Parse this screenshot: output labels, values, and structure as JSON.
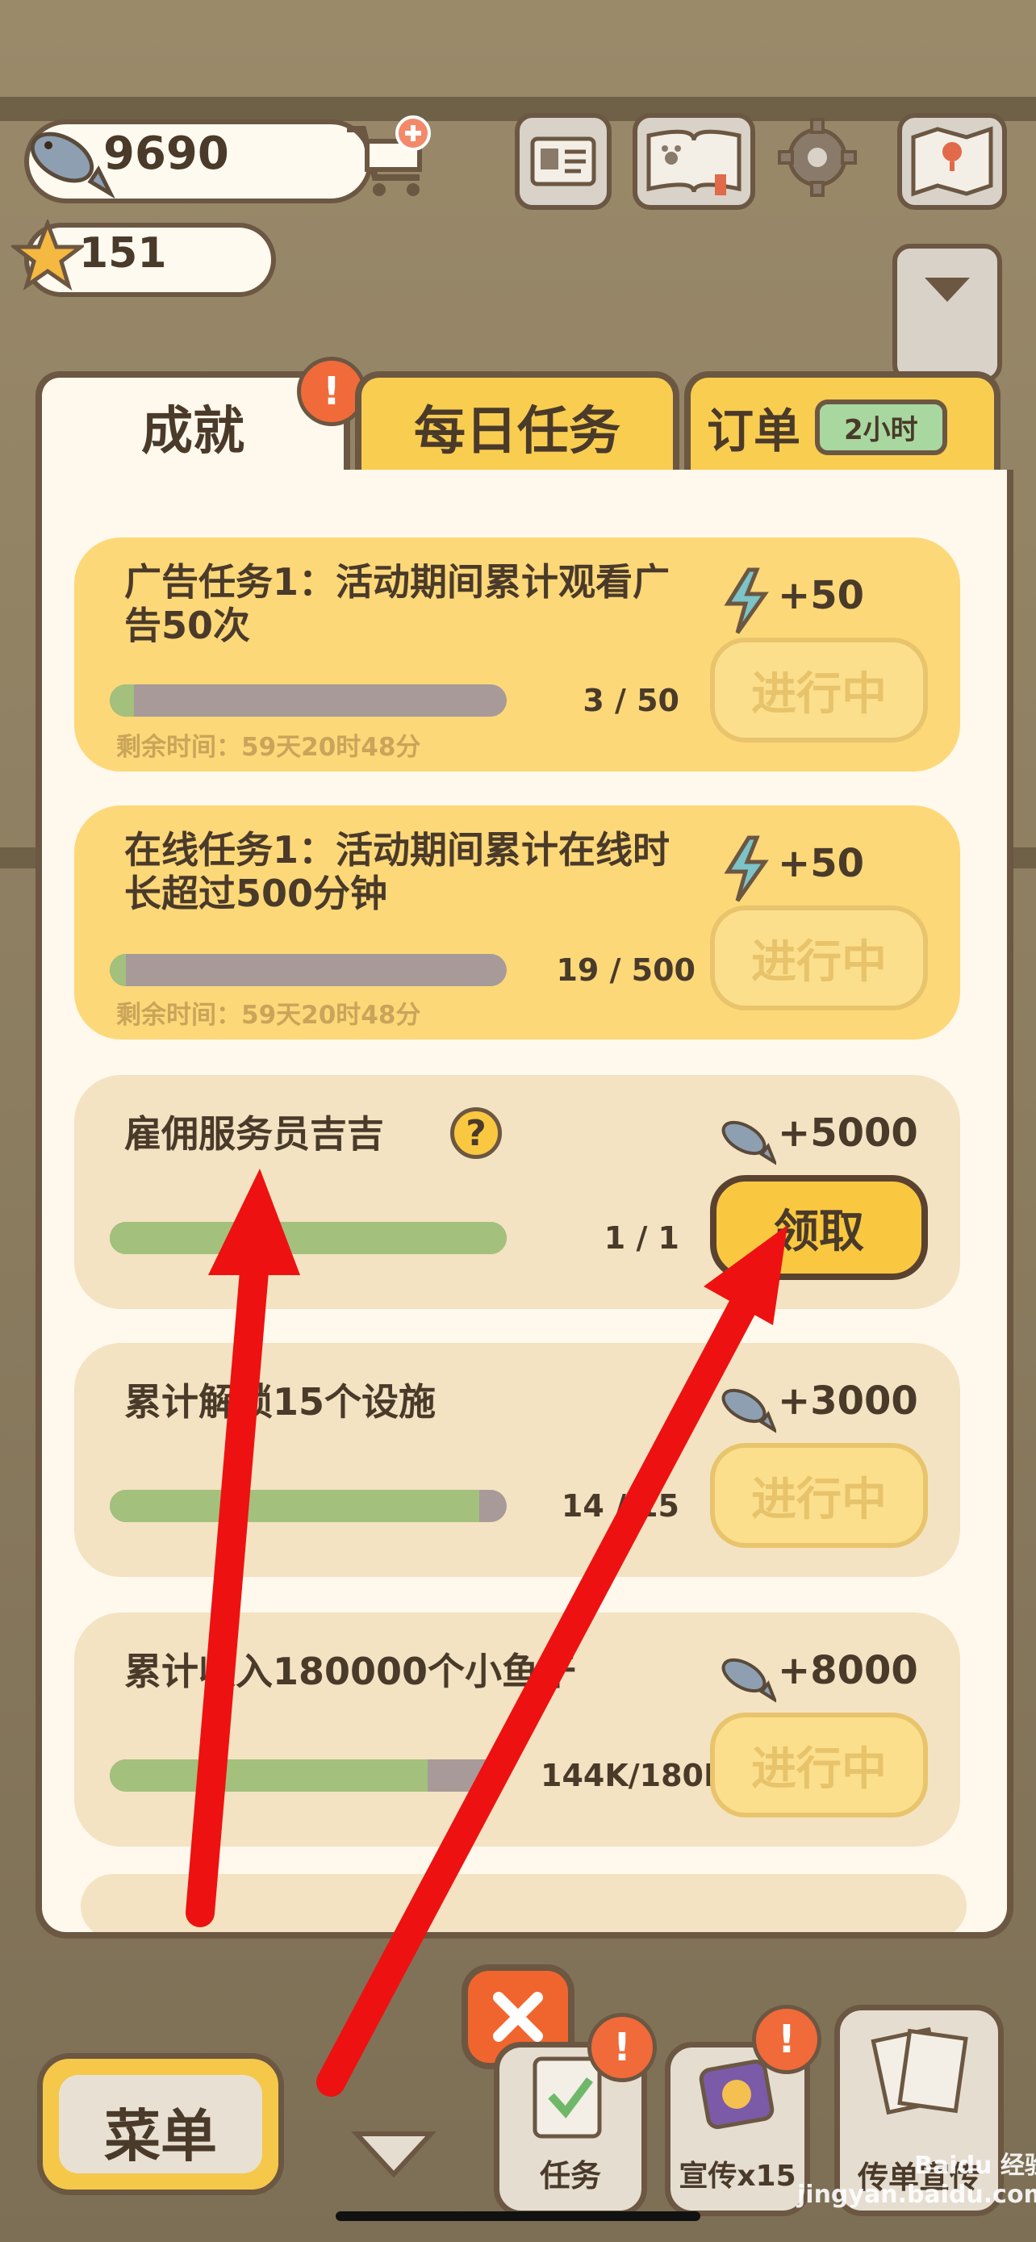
{
  "hud": {
    "fish_count": "9690",
    "star_count": "151"
  },
  "tabs": {
    "achievements": "成就",
    "daily": "每日任务",
    "orders": "订单",
    "orders_timer": "2小时"
  },
  "tasks": [
    {
      "title": "广告任务1：活动期间累计观看广告50次",
      "progress": "3  /  50",
      "progress_fraction": 0.06,
      "remaining": "剩余时间：59天20时48分",
      "reward": "+50",
      "reward_icon": "lightning-icon",
      "button": "进行中"
    },
    {
      "title": "在线任务1：活动期间累计在线时长超过500分钟",
      "progress": "19  / 500",
      "progress_fraction": 0.04,
      "remaining": "剩余时间：59天20时48分",
      "reward": "+50",
      "reward_icon": "lightning-icon",
      "button": "进行中"
    },
    {
      "title": "雇佣服务员吉吉",
      "progress": "1  /  1",
      "progress_fraction": 1.0,
      "reward": "+5000",
      "reward_icon": "fish-icon",
      "button": "领取"
    },
    {
      "title": "累计解锁15个设施",
      "progress": "14  /  15",
      "progress_fraction": 0.93,
      "reward": "+3000",
      "reward_icon": "fish-icon",
      "button": "进行中"
    },
    {
      "title": "累计收入180000个小鱼干",
      "progress": "144K/180K",
      "progress_fraction": 0.8,
      "reward": "+8000",
      "reward_icon": "fish-icon",
      "button": "进行中"
    }
  ],
  "bottom": {
    "menu": "菜单",
    "tasks": "任务",
    "promo": "宣传x15",
    "flyer": "传单宣传"
  },
  "watermark": "Baidu 经验\njingyan.baidu.com",
  "colors": {
    "accent_gold": "#f9c840",
    "bar_fill": "#a3c07c",
    "close_orange": "#f0652e",
    "arrow_red": "#ee1111"
  }
}
